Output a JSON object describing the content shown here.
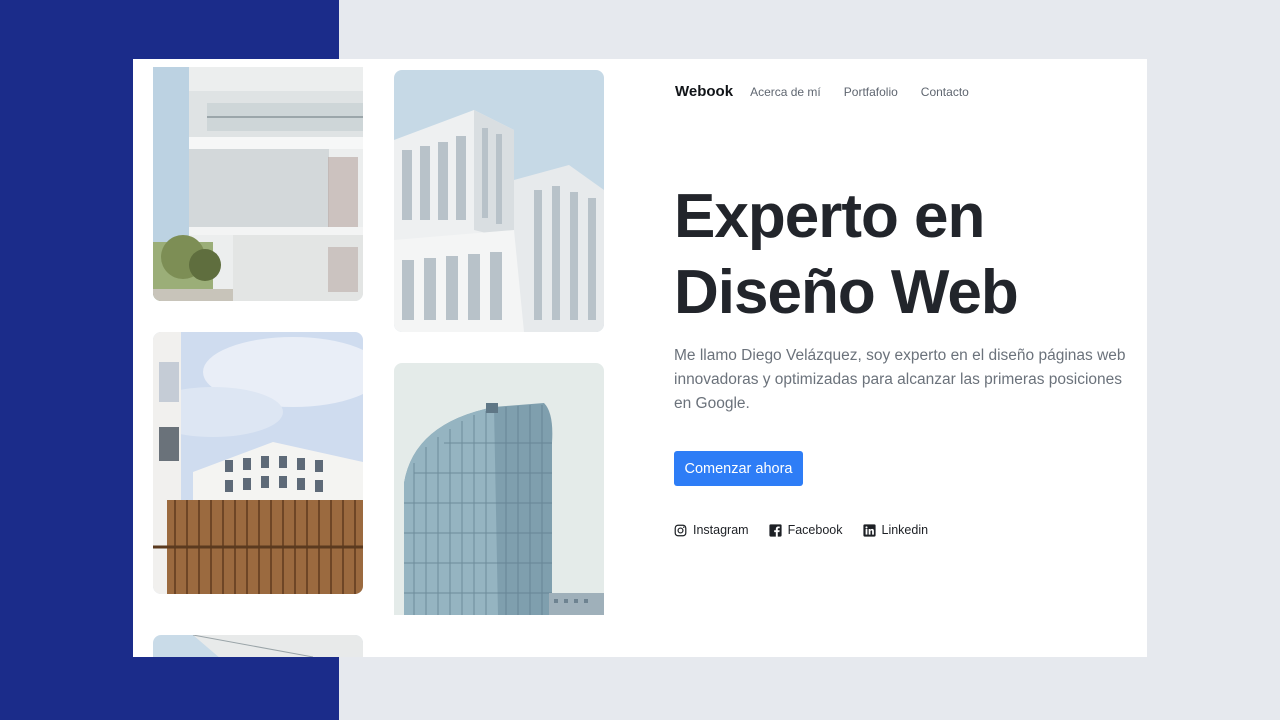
{
  "nav": {
    "brand": "Webook",
    "links": [
      "Acerca de mí",
      "Portfafolio",
      "Contacto"
    ]
  },
  "hero": {
    "title_line1": "Experto en",
    "title_line2": "Diseño Web",
    "description": "Me llamo Diego Velázquez, soy experto en el diseño páginas web innovadoras y optimizadas para alcanzar las primeras posiciones en Google.",
    "cta_label": "Comenzar ahora"
  },
  "social": [
    {
      "label": "Instagram",
      "icon": "instagram-icon"
    },
    {
      "label": "Facebook",
      "icon": "facebook-icon"
    },
    {
      "label": "Linkedin",
      "icon": "linkedin-icon"
    }
  ],
  "gallery": [
    {
      "icon": "building-photo-balconies"
    },
    {
      "icon": "building-photo-wooden-facade"
    },
    {
      "icon": "building-photo-partial"
    },
    {
      "icon": "building-photo-white-blocks"
    },
    {
      "icon": "building-photo-glass-tower"
    }
  ],
  "colors": {
    "accent": "#2e7df6",
    "side_panel": "#1b2c8a",
    "page_bg": "#e6e9ee",
    "heading": "#22252b",
    "body_text": "#6b727b"
  }
}
